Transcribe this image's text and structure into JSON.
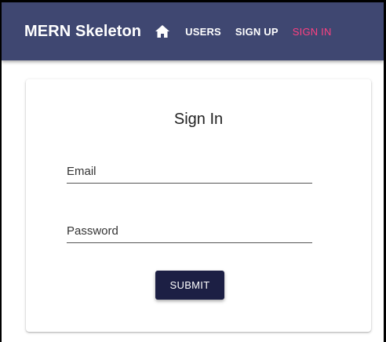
{
  "appbar": {
    "brand": "MERN Skeleton",
    "home_icon": "home-icon",
    "links": [
      "USERS",
      "SIGN UP",
      "SIGN IN"
    ],
    "active_link": "SIGN IN",
    "background_color": "#3f4771",
    "active_color": "#ff4081"
  },
  "signin": {
    "title": "Sign In",
    "email_label": "Email",
    "password_label": "Password",
    "submit_label": "SUBMIT",
    "submit_color": "#1c1f44"
  }
}
